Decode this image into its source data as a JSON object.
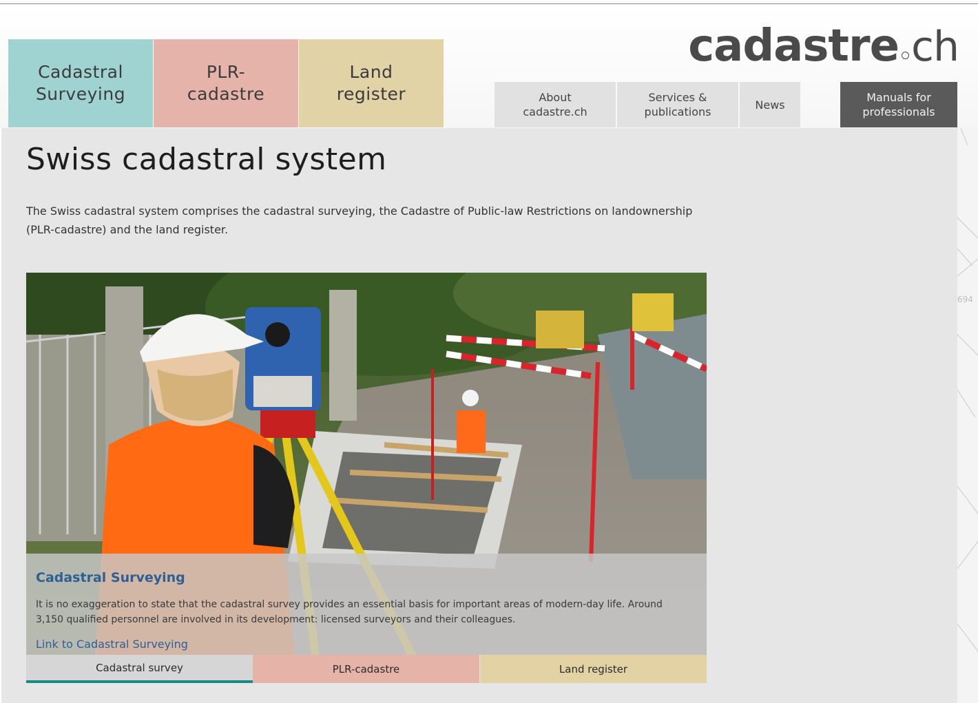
{
  "top_tabs": [
    {
      "label": "Cadastral\nSurveying"
    },
    {
      "label": "PLR-\ncadastre"
    },
    {
      "label": "Land\nregister"
    }
  ],
  "logo": {
    "main": "cadastre",
    "suffix": "ch"
  },
  "nav": [
    {
      "label": "About\ncadastre.ch"
    },
    {
      "label": "Services &\npublications"
    },
    {
      "label": "News"
    },
    {
      "label": "Manuals for\nprofessionals"
    }
  ],
  "page": {
    "title": "Swiss cadastral system",
    "intro": "The Swiss cadastral system comprises the cadastral surveying, the Cadastre of Public-law Restrictions on landownership (PLR-cadastre) and the land register."
  },
  "feature": {
    "title": "Cadastral Surveying",
    "text": "It is no exaggeration to state that the cadastral survey provides an essential basis for important areas of modern-day life. Around 3,150 qualified personnel are involved in its development: licensed surveyors and their colleagues.",
    "link": "Link to Cadastral Surveying"
  },
  "bottom_tabs": [
    {
      "label": "Cadastral survey"
    },
    {
      "label": "PLR-cadastre"
    },
    {
      "label": "Land register"
    }
  ],
  "side_number": "694",
  "colors": {
    "tab_cadastral": "#9fd3d2",
    "tab_plr": "#e5b3a9",
    "tab_land": "#e1d3a6",
    "link_blue": "#2d5f92",
    "active_underline": "#168a86",
    "dark_button": "#5a5a5a"
  }
}
